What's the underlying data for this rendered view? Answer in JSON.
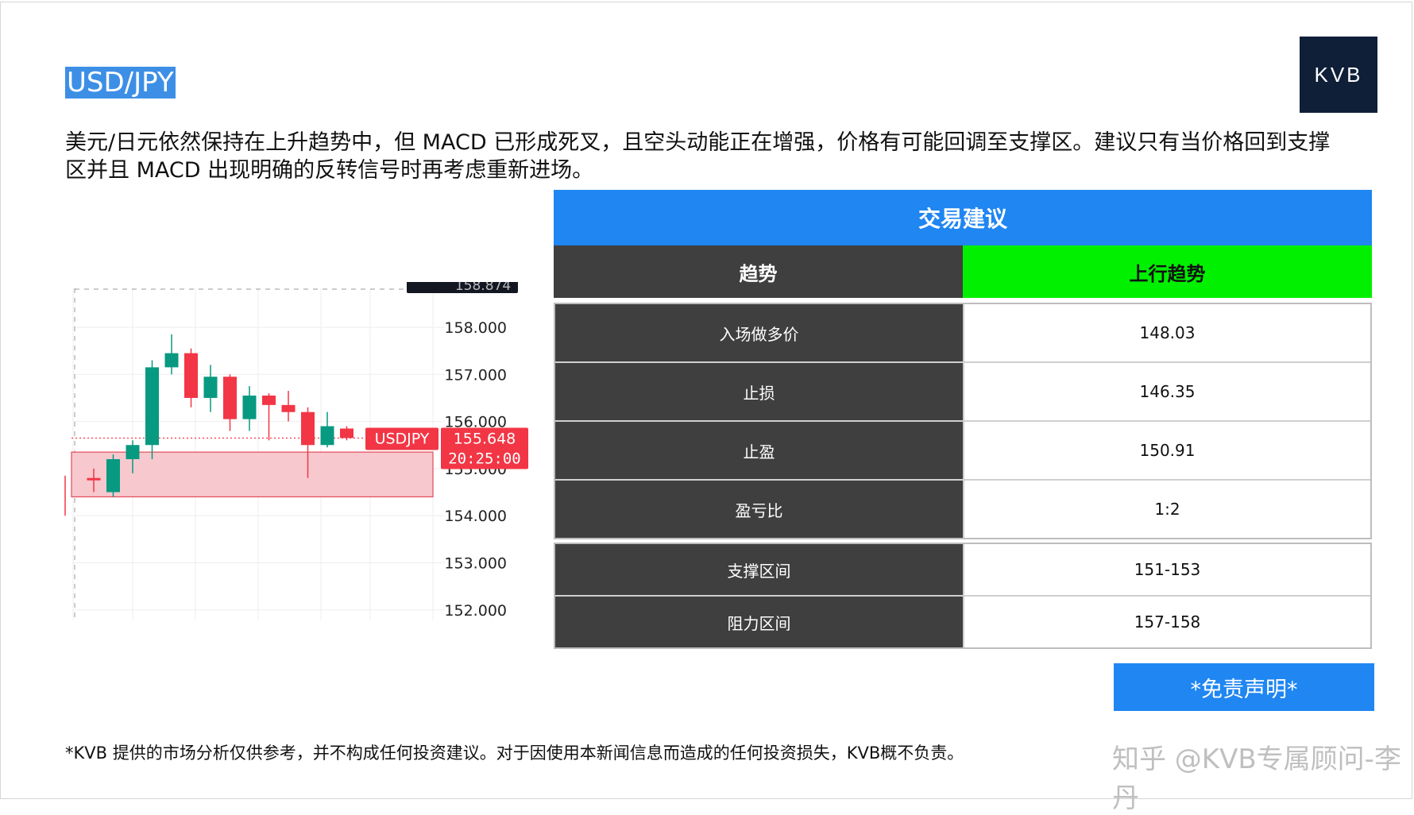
{
  "slide": {
    "title": "USD/JPY",
    "logo_text": "KVB",
    "description": "美元/日元依然保持在上升趋势中，但 MACD 已形成死叉，且空头动能正在增强，价格有可能回调至支撑区。建议只有当价格回到支撑区并且 MACD 出现明确的反转信号时再考虑重新进场。",
    "footnote": "*KVB 提供的市场分析仅供参考，并不构成任何投资建议。对于因使用本新闻信息而造成的任何投资损失，KVB概不负责。",
    "watermark": "知乎 @KVB专属顾问-李丹",
    "disclaimer_button": "*免责声明*"
  },
  "chart": {
    "symbol_label": "USDJPY",
    "price_label": "155.648",
    "time_label": "20:25:00",
    "top_partial_label": "158.874",
    "y_ticks": [
      "158.000",
      "157.000",
      "156.000",
      "155.000",
      "154.000",
      "153.000",
      "152.000"
    ],
    "y_values": [
      158,
      157,
      156,
      155,
      154,
      153,
      152
    ],
    "current_price": 155.648,
    "support_zone": [
      154.4,
      155.35
    ],
    "colors": {
      "up": "#089981",
      "down": "#f23645",
      "zone": "#f7c8cd"
    },
    "candles": [
      {
        "o": 154.8,
        "h": 155.0,
        "l": 154.5,
        "c": 154.75
      },
      {
        "o": 154.5,
        "h": 155.3,
        "l": 154.4,
        "c": 155.2
      },
      {
        "o": 155.2,
        "h": 155.6,
        "l": 154.9,
        "c": 155.5
      },
      {
        "o": 155.5,
        "h": 157.3,
        "l": 155.2,
        "c": 157.15
      },
      {
        "o": 157.15,
        "h": 157.85,
        "l": 157.0,
        "c": 157.45
      },
      {
        "o": 157.45,
        "h": 157.55,
        "l": 156.3,
        "c": 156.5
      },
      {
        "o": 156.5,
        "h": 157.2,
        "l": 156.2,
        "c": 156.95
      },
      {
        "o": 156.95,
        "h": 157.0,
        "l": 155.8,
        "c": 156.05
      },
      {
        "o": 156.05,
        "h": 156.75,
        "l": 155.8,
        "c": 156.55
      },
      {
        "o": 156.55,
        "h": 156.6,
        "l": 155.6,
        "c": 156.35
      },
      {
        "o": 156.35,
        "h": 156.65,
        "l": 156.0,
        "c": 156.2
      },
      {
        "o": 156.2,
        "h": 156.3,
        "l": 154.8,
        "c": 155.5
      },
      {
        "o": 155.5,
        "h": 156.2,
        "l": 155.45,
        "c": 155.9
      },
      {
        "o": 155.85,
        "h": 155.9,
        "l": 155.6,
        "c": 155.65
      }
    ]
  },
  "trade": {
    "header": "交易建议",
    "trend_label": "趋势",
    "trend_value": "上行趋势",
    "rows": [
      {
        "label": "入场做多价",
        "value": "148.03"
      },
      {
        "label": "止损",
        "value": "146.35"
      },
      {
        "label": "止盈",
        "value": "150.91"
      },
      {
        "label": "盈亏比",
        "value": "1:2"
      }
    ],
    "zones": [
      {
        "label": "支撑区间",
        "value": "151-153"
      },
      {
        "label": "阻力区间",
        "value": "157-158"
      }
    ]
  }
}
